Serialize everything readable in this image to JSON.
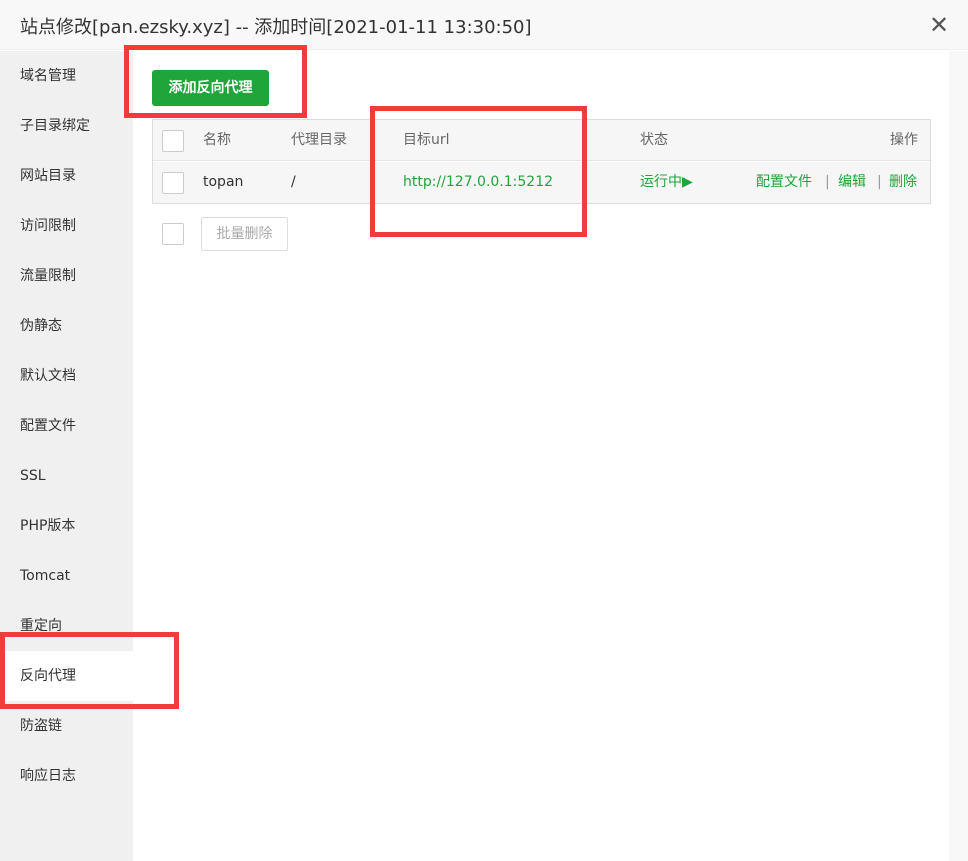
{
  "dialog": {
    "title": "站点修改[pan.ezsky.xyz] -- 添加时间[2021-01-11 13:30:50]",
    "close_icon": "✕"
  },
  "sidebar": {
    "items": [
      {
        "label": "域名管理"
      },
      {
        "label": "子目录绑定"
      },
      {
        "label": "网站目录"
      },
      {
        "label": "访问限制"
      },
      {
        "label": "流量限制"
      },
      {
        "label": "伪静态"
      },
      {
        "label": "默认文档"
      },
      {
        "label": "配置文件"
      },
      {
        "label": "SSL"
      },
      {
        "label": "PHP版本"
      },
      {
        "label": "Tomcat"
      },
      {
        "label": "重定向"
      },
      {
        "label": "反向代理",
        "active": true
      },
      {
        "label": "防盗链"
      },
      {
        "label": "响应日志"
      }
    ]
  },
  "main": {
    "add_button": "添加反向代理",
    "table": {
      "headers": {
        "name": "名称",
        "proxy_dir": "代理目录",
        "target_url": "目标url",
        "status": "状态",
        "actions": "操作"
      },
      "rows": [
        {
          "name": "topan",
          "proxy_dir": "/",
          "target_url": "http://127.0.0.1:5212",
          "status": "运行中▶",
          "actions": {
            "config": "配置文件",
            "edit": "编辑",
            "delete": "删除",
            "separator": "|"
          }
        }
      ]
    },
    "batch_delete_button": "批量删除"
  },
  "colors": {
    "accent_green": "#20a53a",
    "annotation_red": "#f23b3b"
  },
  "icons": {
    "close": "close-icon",
    "play": "play-icon"
  }
}
